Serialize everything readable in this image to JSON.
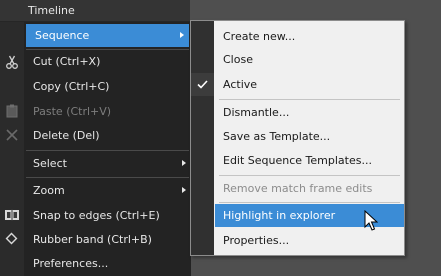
{
  "header": {
    "title": "Timeline"
  },
  "main_menu": {
    "items": [
      {
        "label": "Sequence",
        "has_submenu": true,
        "highlighted": true
      },
      {
        "label": "Cut (Ctrl+X)",
        "icon": "scissors-icon"
      },
      {
        "label": "Copy (Ctrl+C)"
      },
      {
        "label": "Paste (Ctrl+V)",
        "disabled": true,
        "icon": "paste-icon"
      },
      {
        "label": "Delete (Del)",
        "icon": "delete-x-icon"
      },
      {
        "label": "Select",
        "has_submenu": true
      },
      {
        "label": "Zoom",
        "has_submenu": true
      },
      {
        "label": "Snap to edges (Ctrl+E)",
        "icon": "snap-edges-icon"
      },
      {
        "label": "Rubber band (Ctrl+B)",
        "icon": "rubber-band-icon"
      },
      {
        "label": "Preferences..."
      }
    ]
  },
  "sequence_submenu": {
    "items": [
      {
        "label": "Create new..."
      },
      {
        "label": "Close"
      },
      {
        "label": "Active",
        "checked": true
      },
      {
        "label": "Dismantle..."
      },
      {
        "label": "Save as Template..."
      },
      {
        "label": "Edit Sequence Templates..."
      },
      {
        "label": "Remove match frame edits",
        "disabled": true
      },
      {
        "label": "Highlight in explorer",
        "highlighted": true
      },
      {
        "label": "Properties..."
      }
    ]
  },
  "colors": {
    "highlight": "#3b8cd6",
    "menu_dark": "#232323",
    "submenu_light": "#f0f0f0",
    "disabled_text": "#7d7d7d"
  }
}
